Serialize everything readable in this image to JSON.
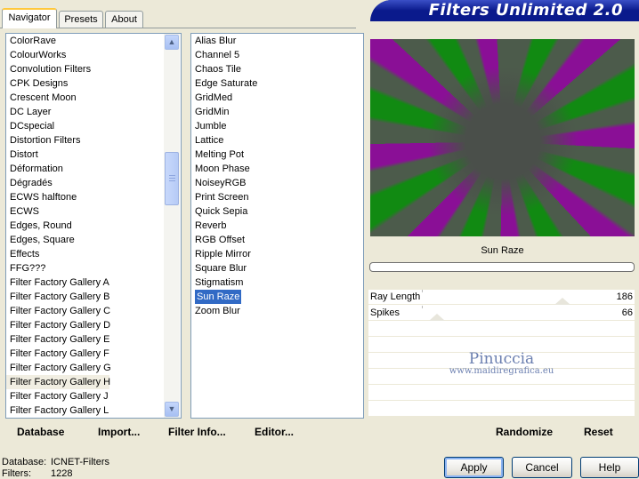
{
  "tabs": [
    {
      "label": "Navigator",
      "active": true
    },
    {
      "label": "Presets",
      "active": false
    },
    {
      "label": "About",
      "active": false
    }
  ],
  "banner": {
    "title": "Filters Unlimited 2.0"
  },
  "categories": {
    "items": [
      "ColorRave",
      "ColourWorks",
      "Convolution Filters",
      "CPK Designs",
      "Crescent Moon",
      "DC Layer",
      "DCspecial",
      "Distortion Filters",
      "Distort",
      "Déformation",
      "Dégradés",
      "ECWS halftone",
      "ECWS",
      "Edges, Round",
      "Edges, Square",
      "Effects",
      "FFG???",
      "Filter Factory Gallery A",
      "Filter Factory Gallery B",
      "Filter Factory Gallery C",
      "Filter Factory Gallery D",
      "Filter Factory Gallery E",
      "Filter Factory Gallery F",
      "Filter Factory Gallery G",
      "Filter Factory Gallery H",
      "Filter Factory Gallery J",
      "Filter Factory Gallery L"
    ],
    "selected": "Filter Factory Gallery H"
  },
  "filters": {
    "items": [
      "Alias Blur",
      "Channel 5",
      "Chaos Tile",
      "Edge Saturate",
      "GridMed",
      "GridMin",
      "Jumble",
      "Lattice",
      "Melting Pot",
      "Moon Phase",
      "NoiseyRGB",
      "Print Screen",
      "Quick Sepia",
      "Reverb",
      "RGB Offset",
      "Ripple Mirror",
      "Square Blur",
      "Stigmatism",
      "Sun Raze",
      "Zoom Blur"
    ],
    "selected": "Sun Raze"
  },
  "preview": {
    "filter_name": "Sun Raze",
    "colors": [
      "#4c5b4b",
      "#118a12",
      "#8a0f96"
    ]
  },
  "params": [
    {
      "label": "Ray Length",
      "value": "186",
      "level": 0.73
    },
    {
      "label": "Spikes",
      "value": "66",
      "level": 0.26
    }
  ],
  "watermark": {
    "line1": "Pinuccia",
    "line2": "www.maidiregrafica.eu"
  },
  "toolbar": {
    "database": "Database",
    "import": "Import...",
    "filter_info": "Filter Info...",
    "editor": "Editor...",
    "randomize": "Randomize",
    "reset": "Reset"
  },
  "status": {
    "database_label": "Database:",
    "database_value": "ICNET-Filters",
    "filters_label": "Filters:",
    "filters_value": "1228"
  },
  "buttons": {
    "apply": "Apply",
    "cancel": "Cancel",
    "help": "Help"
  },
  "icons": {
    "scroll_up": "chevron-up-icon",
    "scroll_down": "chevron-down-icon"
  }
}
